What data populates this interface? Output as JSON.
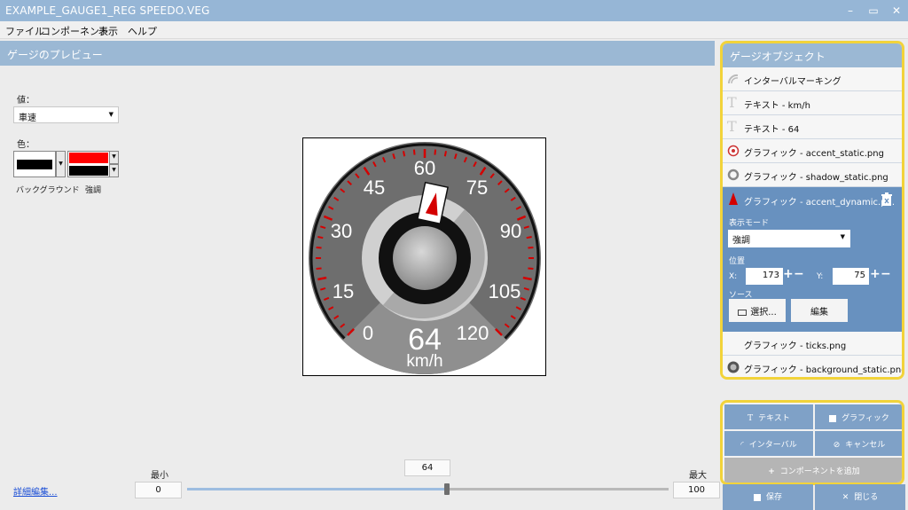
{
  "window": {
    "title": "EXAMPLE_GAUGE1_REG SPEEDO.VEG",
    "minimize": "–",
    "restore": "▭",
    "close": "✕"
  },
  "menu": {
    "file": "ファイル",
    "component": "コンポーネント",
    "view": "表示",
    "help": "ヘルプ"
  },
  "preview": {
    "header": "ゲージのプレビュー",
    "value_label": "値：",
    "value_select": "車速",
    "color_label": "色：",
    "background_label": "バックグラウンド",
    "accent_label": "強調",
    "background_color": "#000000",
    "accent_color": "#ff0000",
    "accent_color_2": "#000000"
  },
  "gauge": {
    "ticks": [
      "0",
      "15",
      "30",
      "45",
      "60",
      "75",
      "90",
      "105",
      "120"
    ],
    "value": "64",
    "unit": "km/h",
    "accent_color": "#d40000"
  },
  "slider": {
    "min_label": "最小",
    "max_label": "最大",
    "min": "0",
    "max": "100",
    "current": "64",
    "current_fraction": 0.64
  },
  "advanced_link": "詳細編集...",
  "objects": {
    "header": "ゲージオブジェクト",
    "items": [
      {
        "label": "インターバルマーキング",
        "icon": "interval-marking-icon"
      },
      {
        "label": "テキスト - km/h",
        "icon": "text-icon"
      },
      {
        "label": "テキスト - 64",
        "icon": "text-icon"
      },
      {
        "label": "グラフィック - accent_static.png",
        "icon": "target-icon"
      },
      {
        "label": "グラフィック - shadow_static.png",
        "icon": "ring-icon"
      },
      {
        "label": "グラフィック - accent_dynamic.p...",
        "icon": "needle-icon"
      },
      {
        "label": "グラフィック - ticks.png",
        "icon": ""
      },
      {
        "label": "グラフィック - background_static.png",
        "icon": "dial-icon"
      }
    ],
    "selected": {
      "display_mode_label": "表示モード",
      "display_mode": "強調",
      "position_label": "位置",
      "x_label": "X:",
      "x": "173",
      "y_label": "Y:",
      "y": "75",
      "source_label": "ソース",
      "select_button": "選択...",
      "edit_button": "編集",
      "delete_icon": "trash-icon"
    }
  },
  "actions": {
    "text": "テキスト",
    "graphic": "グラフィック",
    "interval": "インターバル",
    "cancel": "キャンセル",
    "add_component": "コンポーネントを追加",
    "save": "保存",
    "close": "閉じる"
  }
}
